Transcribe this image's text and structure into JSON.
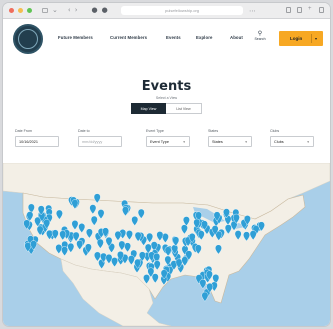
{
  "browser": {
    "url": "pulsefellowship.org",
    "traffic_lights": [
      "#f06d5c",
      "#f5bd4f",
      "#5fc454"
    ]
  },
  "header": {
    "nav": [
      "Future Members",
      "Current Members",
      "Events",
      "Explore",
      "About"
    ],
    "search_label": "Search",
    "login_label": "Login",
    "accent": "#f7a823"
  },
  "page": {
    "title": "Events",
    "subtitle": "Select a View",
    "views": [
      "Map View",
      "List View"
    ]
  },
  "filters": [
    {
      "label": "Date From",
      "value": "10/16/2021",
      "placeholder": false
    },
    {
      "label": "Date to",
      "value": "mm/dd/yyyy",
      "placeholder": true
    },
    {
      "label": "Event Type",
      "value": "Event Type",
      "placeholder": false
    },
    {
      "label": "States",
      "value": "States",
      "placeholder": false
    },
    {
      "label": "Clubs",
      "value": "Clubs",
      "placeholder": false
    }
  ],
  "map": {
    "water_color": "#a9cfe9",
    "land_color": "#f3efe6",
    "marker_color": "#2f9fd6",
    "marker_count": 190
  }
}
